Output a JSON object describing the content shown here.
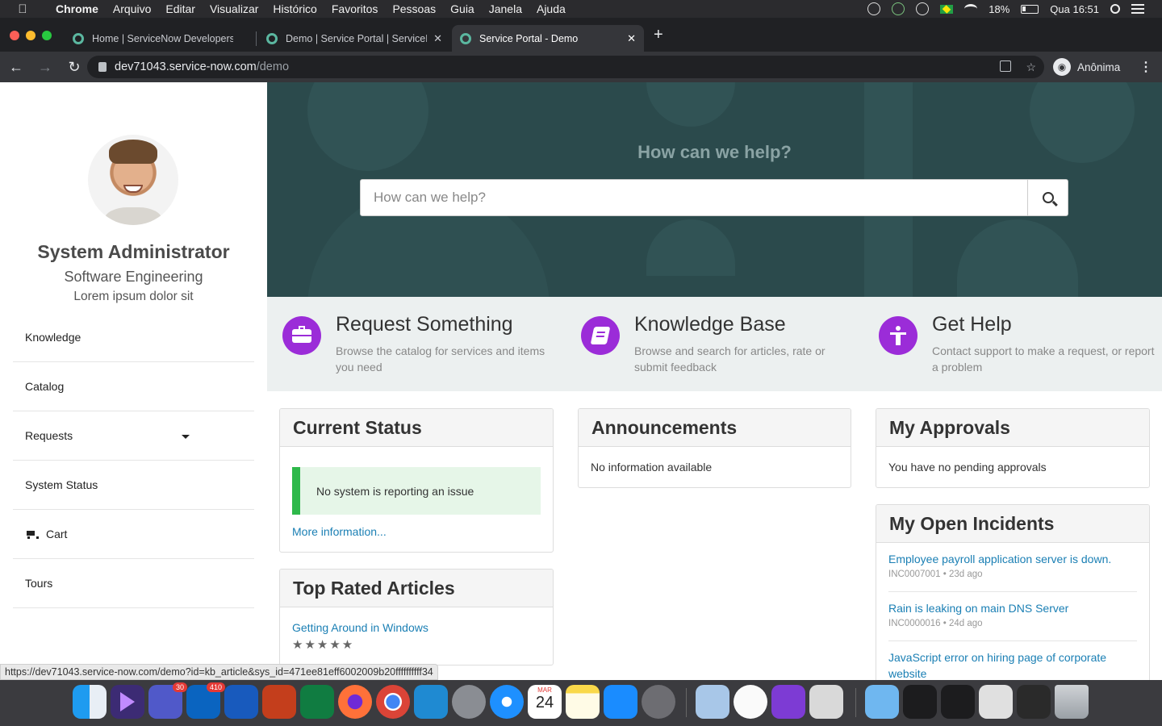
{
  "menubar": {
    "app": "Chrome",
    "items": [
      "Arquivo",
      "Editar",
      "Visualizar",
      "Histórico",
      "Favoritos",
      "Pessoas",
      "Guia",
      "Janela",
      "Ajuda"
    ],
    "battery": "18%",
    "clock": "Qua 16:51"
  },
  "tabs": [
    {
      "title": "Home | ServiceNow Developers"
    },
    {
      "title": "Demo | Service Portal | ServiceNow"
    },
    {
      "title": "Service Portal - Demo"
    }
  ],
  "tab_close": "✕",
  "new_tab": "+",
  "address": {
    "host": "dev71043.service-now.com",
    "path": "/demo"
  },
  "profile": {
    "label": "Anônima"
  },
  "sidebar": {
    "name": "System Administrator",
    "department": "Software Engineering",
    "tagline": "Lorem ipsum dolor sit",
    "items": [
      {
        "label": "Knowledge"
      },
      {
        "label": "Catalog"
      },
      {
        "label": "Requests"
      },
      {
        "label": "System Status"
      },
      {
        "label": "Cart"
      },
      {
        "label": "Tours"
      }
    ]
  },
  "hero": {
    "title": "How can we help?",
    "search_placeholder": "How can we help?"
  },
  "quick": [
    {
      "title": "Request Something",
      "desc": "Browse the catalog for services and items you need",
      "icon": "briefcase-icon"
    },
    {
      "title": "Knowledge Base",
      "desc": "Browse and search for articles, rate or submit feedback",
      "icon": "book-icon"
    },
    {
      "title": "Get Help",
      "desc": "Contact support to make a request, or report a problem",
      "icon": "person-icon"
    }
  ],
  "current_status": {
    "title": "Current Status",
    "message": "No system is reporting an issue",
    "more": "More information..."
  },
  "top_rated": {
    "title": "Top Rated Articles",
    "article": "Getting Around in Windows",
    "stars": "★★★★★"
  },
  "announcements": {
    "title": "Announcements",
    "empty": "No information available"
  },
  "approvals": {
    "title": "My Approvals",
    "empty": "You have no pending approvals"
  },
  "incidents": {
    "title": "My Open Incidents",
    "items": [
      {
        "title": "Employee payroll application server is down.",
        "meta": "INC0007001 • 23d ago"
      },
      {
        "title": "Rain is leaking on main DNS Server",
        "meta": "INC0000016 • 24d ago"
      },
      {
        "title": "JavaScript error on hiring page of corporate website",
        "meta": ""
      }
    ]
  },
  "statusbar": "https://dev71043.service-now.com/demo?id=kb_article&sys_id=471ee81eff6002009b20ffffffffff34",
  "dock": {
    "teams_badge": "30",
    "outlook_badge": "410",
    "calendar_month": "MAR",
    "calendar_day": "24"
  },
  "colors": {
    "hero": "#2b4a4c",
    "accent": "#9b2cd8",
    "link": "#1a7fb4",
    "status_green": "#2eb84a"
  }
}
